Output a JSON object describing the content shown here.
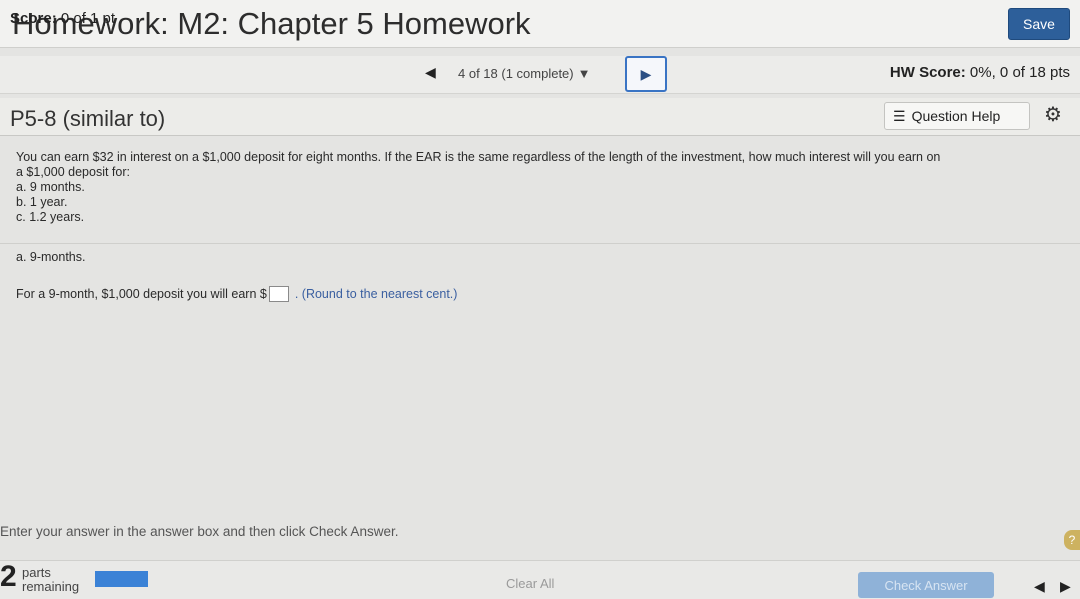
{
  "header": {
    "title": "Homework: M2: Chapter 5 Homework",
    "save_label": "Save"
  },
  "scorebar": {
    "score_label": "Score:",
    "score_value": "0 of 1 pt",
    "question_select": "4 of 18 (1 complete)",
    "hw_score_label": "HW Score:",
    "hw_score_value": "0%, 0 of 18 pts"
  },
  "question": {
    "id": "P5-8 (similar to)",
    "help_label": "Question Help",
    "problem_lines": [
      "You can earn $32 in interest on a $1,000 deposit for eight months. If the EAR is the same regardless of the length of the investment, how much interest will you earn on",
      "a $1,000 deposit for:",
      "a. 9 months.",
      "b. 1 year.",
      "c. 1.2 years."
    ],
    "part_label": "a. 9-months.",
    "answer_prefix": "For a 9-month, $1,000 deposit you will earn $",
    "answer_value": "",
    "answer_suffix": ". (Round to the nearest cent.)"
  },
  "footer": {
    "instruction": "Enter your answer in the answer box and then click Check Answer.",
    "parts_count": "2",
    "parts_line1": "parts",
    "parts_line2": "remaining",
    "progress_fraction": 1.0,
    "clear_all_label": "Clear All",
    "check_answer_label": "Check Answer"
  },
  "icons": {
    "prev": "◀",
    "next": "▶",
    "dropdown": "▼",
    "list": "☰",
    "gear": "⚙",
    "help": "?"
  },
  "colors": {
    "accent": "#2d5f9a",
    "link": "#3a5fa0",
    "progress": "#3b82d6"
  }
}
